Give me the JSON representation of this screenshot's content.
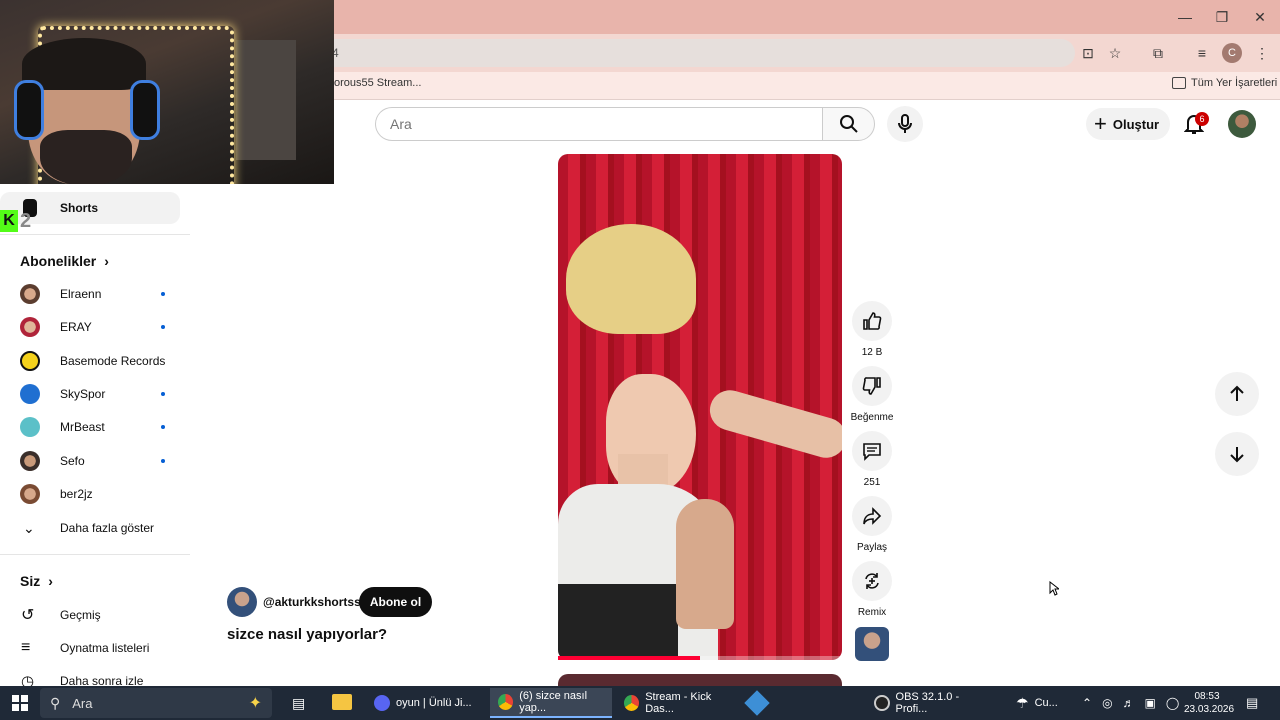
{
  "browser": {
    "url_fragment": "4",
    "bookmark_item": "orous55 Stream...",
    "all_bookmarks": "Tüm Yer İşaretleri",
    "profile_initial": "C"
  },
  "header": {
    "search_placeholder": "Ara",
    "create_label": "Oluştur",
    "notification_count": "6"
  },
  "sidebar": {
    "shorts_label": "Shorts",
    "subscriptions_heading": "Abonelikler",
    "subscriptions": [
      {
        "label": "Elraenn",
        "new": true
      },
      {
        "label": "ERAY",
        "new": true
      },
      {
        "label": "Basemode Records",
        "new": false
      },
      {
        "label": "SkySpor",
        "new": true
      },
      {
        "label": "MrBeast",
        "new": true
      },
      {
        "label": "Sefo",
        "new": true
      },
      {
        "label": "ber2jz",
        "new": false
      }
    ],
    "show_more": "Daha fazla göster",
    "you_heading": "Siz",
    "you_items": [
      "Geçmiş",
      "Oynatma listeleri",
      "Daha sonra izle"
    ]
  },
  "webcam": {
    "kick_badge": "2"
  },
  "short": {
    "channel_handle": "@akturkkshortss",
    "subscribe_label": "Abone ol",
    "title": "sizce nasıl yapıyorlar?",
    "progress_fraction": 0.5
  },
  "actions": {
    "likes": "12 B",
    "dislike": "Beğenme",
    "comments": "251",
    "share": "Paylaş",
    "remix": "Remix"
  },
  "taskbar": {
    "search_label": "Ara",
    "apps": [
      "oyun | Ünlü Ji...",
      "(6) sizce nasıl yap...",
      "Stream - Kick Das...",
      "OBS 32.1.0 - Profi...",
      "Cu..."
    ],
    "time": "08:53",
    "date": "23.03.2026"
  }
}
